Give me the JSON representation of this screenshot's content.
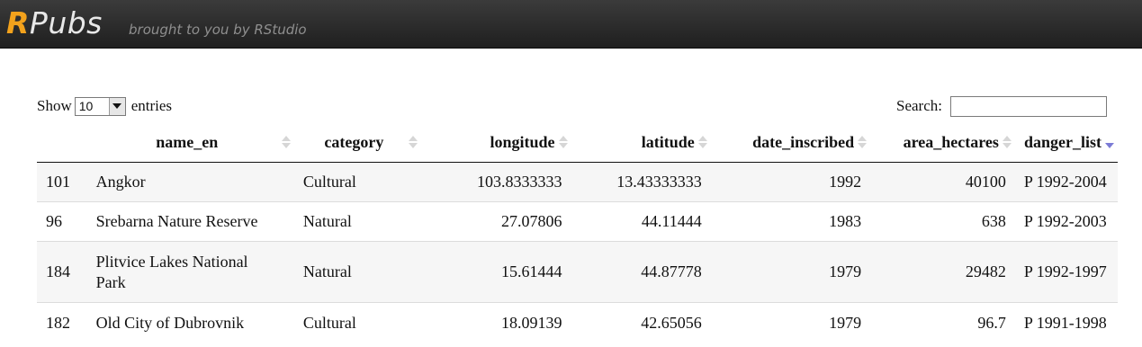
{
  "header": {
    "brand_r": "R",
    "brand_rest": "Pubs",
    "tagline": "brought to you by RStudio"
  },
  "controls": {
    "show_label": "Show",
    "entries_value": "10",
    "entries_label": "entries",
    "search_label": "Search:",
    "search_value": ""
  },
  "table": {
    "columns": [
      "name_en",
      "category",
      "longitude",
      "latitude",
      "date_inscribed",
      "area_hectares",
      "danger_list"
    ],
    "sorted_column": "danger_list",
    "sort_direction": "descending",
    "rows": [
      {
        "id": "101",
        "name_en": "Angkor",
        "category": "Cultural",
        "longitude": "103.8333333",
        "latitude": "13.43333333",
        "date_inscribed": "1992",
        "area_hectares": "40100",
        "danger_list": "P 1992-2004"
      },
      {
        "id": "96",
        "name_en": "Srebarna Nature Reserve",
        "category": "Natural",
        "longitude": "27.07806",
        "latitude": "44.11444",
        "date_inscribed": "1983",
        "area_hectares": "638",
        "danger_list": "P 1992-2003"
      },
      {
        "id": "184",
        "name_en": "Plitvice Lakes National Park",
        "category": "Natural",
        "longitude": "15.61444",
        "latitude": "44.87778",
        "date_inscribed": "1979",
        "area_hectares": "29482",
        "danger_list": "P 1992-1997"
      },
      {
        "id": "182",
        "name_en": "Old City of Dubrovnik",
        "category": "Cultural",
        "longitude": "18.09139",
        "latitude": "42.65056",
        "date_inscribed": "1979",
        "area_hectares": "96.7",
        "danger_list": "P 1991-1998"
      }
    ]
  },
  "colors": {
    "header_bg": "#2b2b2b",
    "brand_accent": "#f3a21c",
    "sort_active": "#7b7bd6"
  }
}
